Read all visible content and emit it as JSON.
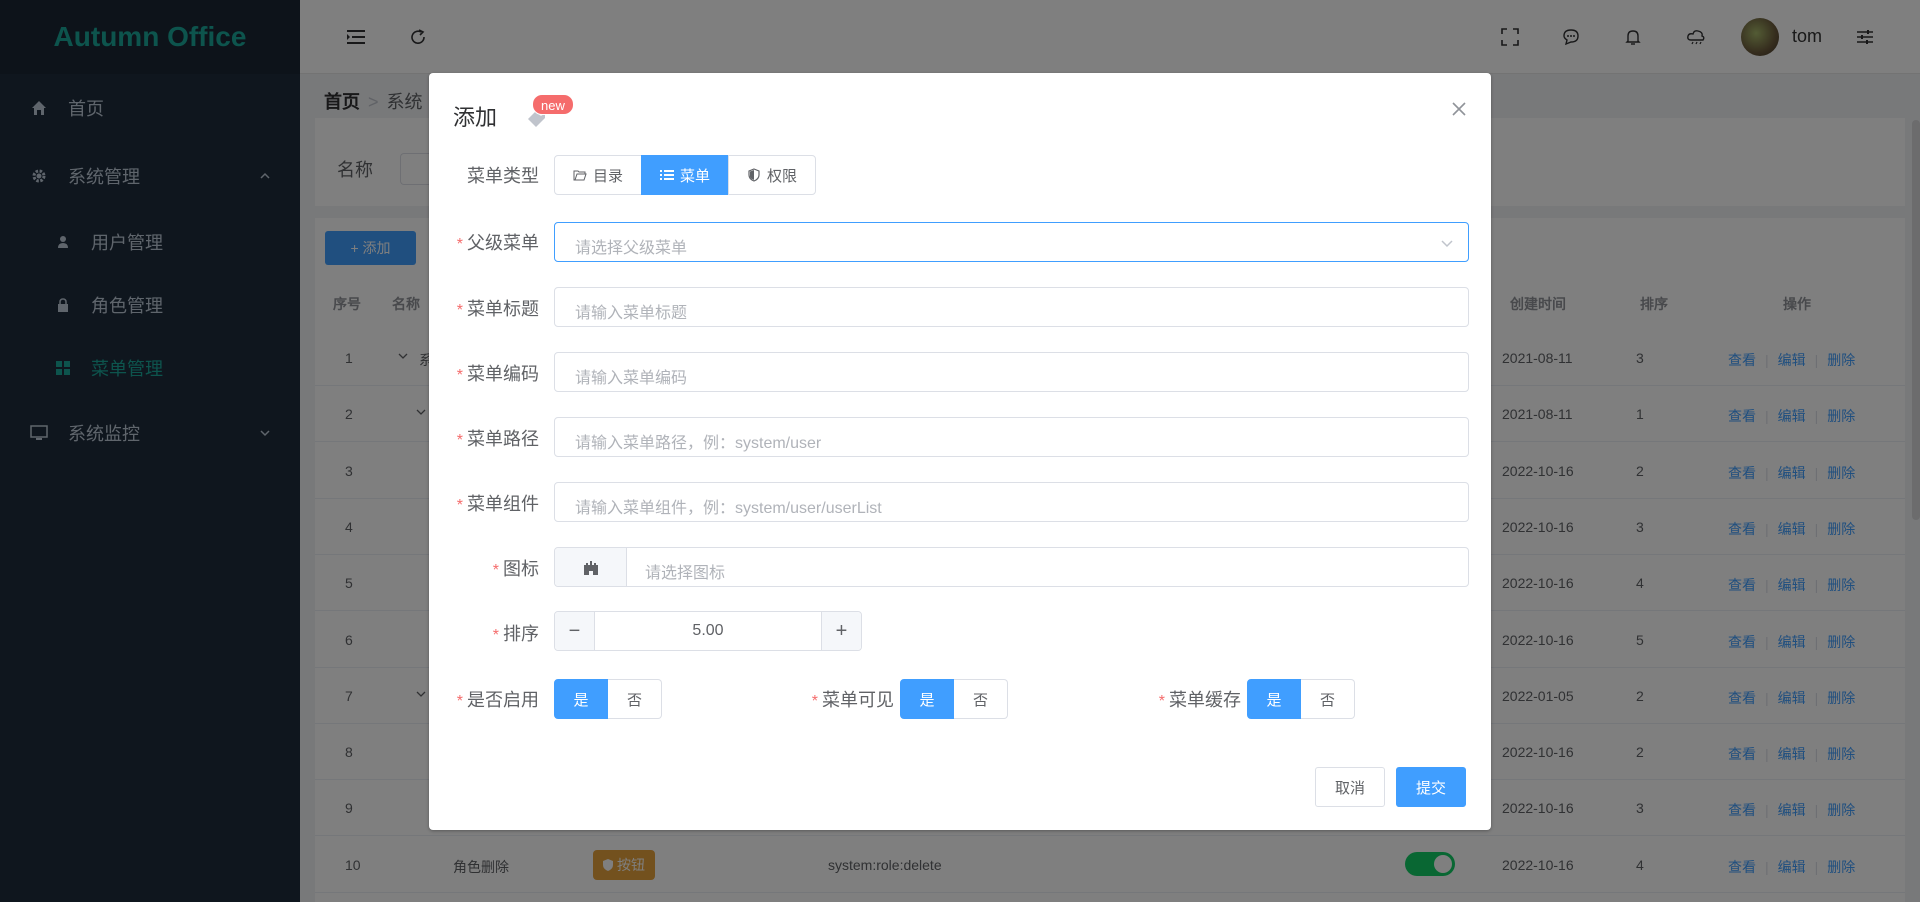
{
  "app": {
    "title": "Autumn Office"
  },
  "colors": {
    "accent": "#409eff",
    "brand": "#1aa89b",
    "danger": "#f56c6c",
    "success": "#13ce66",
    "warning": "#e6a23c",
    "sidebar_bg": "#1f2d3d"
  },
  "sidebar": {
    "home": "首页",
    "system_mgmt": "系统管理",
    "items": [
      {
        "label": "用户管理",
        "icon": "user-icon"
      },
      {
        "label": "角色管理",
        "icon": "lock-icon"
      },
      {
        "label": "菜单管理",
        "icon": "grid-icon",
        "active": true
      }
    ],
    "monitor": "系统监控"
  },
  "header": {
    "username": "tom"
  },
  "breadcrumb": {
    "home": "首页",
    "current": "系统"
  },
  "search": {
    "name_label": "名称"
  },
  "table": {
    "add_label": "+ 添加",
    "headers": {
      "index": "序号",
      "name": "名称",
      "created": "创建时间",
      "sort": "排序",
      "ops": "操作"
    },
    "rows": [
      {
        "index": "1",
        "date": "2021-08-11",
        "sort": "3",
        "name": "系"
      },
      {
        "index": "2",
        "date": "2021-08-11",
        "sort": "1"
      },
      {
        "index": "3",
        "date": "2022-10-16",
        "sort": "2"
      },
      {
        "index": "4",
        "date": "2022-10-16",
        "sort": "3"
      },
      {
        "index": "5",
        "date": "2022-10-16",
        "sort": "4"
      },
      {
        "index": "6",
        "date": "2022-10-16",
        "sort": "5"
      },
      {
        "index": "7",
        "date": "2022-01-05",
        "sort": "2"
      },
      {
        "index": "8",
        "date": "2022-10-16",
        "sort": "2"
      },
      {
        "index": "9",
        "date": "2022-10-16",
        "sort": "3"
      },
      {
        "index": "10",
        "date": "2022-10-16",
        "sort": "4",
        "name": "角色删除",
        "type": "按钮",
        "code": "system:role:delete"
      }
    ],
    "op_view": "查看",
    "op_edit": "编辑",
    "op_delete": "删除"
  },
  "dialog": {
    "title": "添加",
    "badge": "new",
    "menu_type": {
      "label": "菜单类型",
      "options": [
        "目录",
        "菜单",
        "权限"
      ],
      "selected": "菜单"
    },
    "parent": {
      "label": "父级菜单",
      "placeholder": "请选择父级菜单"
    },
    "menu_title": {
      "label": "菜单标题",
      "placeholder": "请输入菜单标题"
    },
    "menu_code": {
      "label": "菜单编码",
      "placeholder": "请输入菜单编码"
    },
    "menu_path": {
      "label": "菜单路径",
      "placeholder": "请输入菜单路径，例：system/user"
    },
    "menu_component": {
      "label": "菜单组件",
      "placeholder": "请输入菜单组件，例：system/user/userList"
    },
    "icon": {
      "label": "图标",
      "placeholder": "请选择图标"
    },
    "sort": {
      "label": "排序",
      "value": "5.00",
      "minus": "−",
      "plus": "+"
    },
    "enabled": {
      "label": "是否启用",
      "yes": "是",
      "no": "否",
      "selected": "是"
    },
    "visible": {
      "label": "菜单可见",
      "yes": "是",
      "no": "否",
      "selected": "是"
    },
    "cache": {
      "label": "菜单缓存",
      "yes": "是",
      "no": "否",
      "selected": "是"
    },
    "cancel": "取消",
    "submit": "提交"
  }
}
